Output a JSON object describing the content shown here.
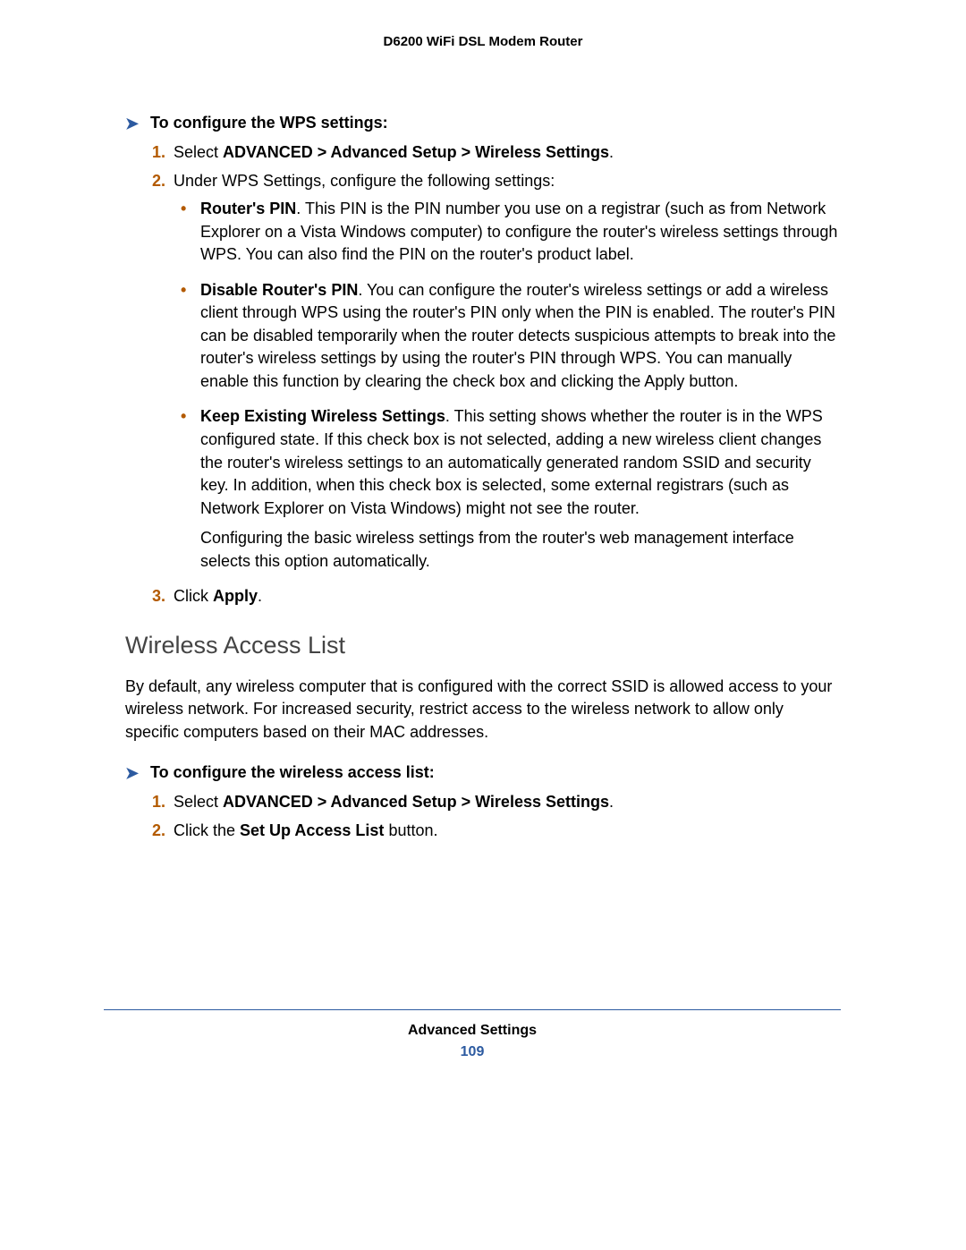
{
  "header": {
    "title": "D6200 WiFi DSL Modem Router"
  },
  "sections": {
    "wps": {
      "heading": "To configure the WPS settings:",
      "steps": {
        "s1": {
          "num": "1.",
          "prefix": "Select ",
          "bold": "ADVANCED > Advanced Setup > Wireless Settings",
          "suffix": "."
        },
        "s2": {
          "num": "2.",
          "text": "Under WPS Settings, configure the following settings:"
        },
        "s3": {
          "num": "3.",
          "prefix": "Click ",
          "bold": "Apply",
          "suffix": "."
        }
      },
      "bullets": {
        "b1": {
          "bold": "Router's PIN",
          "tail": ". This PIN is the PIN number you use on a registrar (such as from Network Explorer on a Vista Windows computer) to configure the router's wireless settings through WPS. You can also find the PIN on the router's product label."
        },
        "b2": {
          "bold": "Disable Router's PIN",
          "tail": ". You can configure the router's wireless settings or add a wireless client through WPS using the router's PIN only when the PIN is enabled. The router's PIN can be disabled temporarily when the router detects suspicious attempts to break into the router's wireless settings by using the router's PIN through WPS. You can manually enable this function by clearing the check box and clicking the Apply button."
        },
        "b3": {
          "bold": "Keep Existing Wireless Settings",
          "tail": ". This setting shows whether the router is in the WPS configured state. If this check box is not selected, adding a new wireless client changes the router's wireless settings to an automatically generated random SSID and security key. In addition, when this check box is selected, some external registrars (such as Network Explorer on Vista Windows) might not see the router.",
          "extra": "Configuring the basic wireless settings from the router's web management interface selects this option automatically."
        }
      }
    },
    "wal": {
      "title": "Wireless Access List",
      "intro": "By default, any wireless computer that is configured with the correct SSID is allowed access to your wireless network. For increased security, restrict access to the wireless network to allow only specific computers based on their MAC addresses.",
      "heading": "To configure the wireless access list:",
      "steps": {
        "s1": {
          "num": "1.",
          "prefix": "Select ",
          "bold": "ADVANCED > Advanced Setup > Wireless Settings",
          "suffix": "."
        },
        "s2": {
          "num": "2.",
          "prefix": "Click the ",
          "bold": "Set Up Access List",
          "suffix": " button."
        }
      }
    }
  },
  "footer": {
    "chapter": "Advanced Settings",
    "page": "109"
  }
}
